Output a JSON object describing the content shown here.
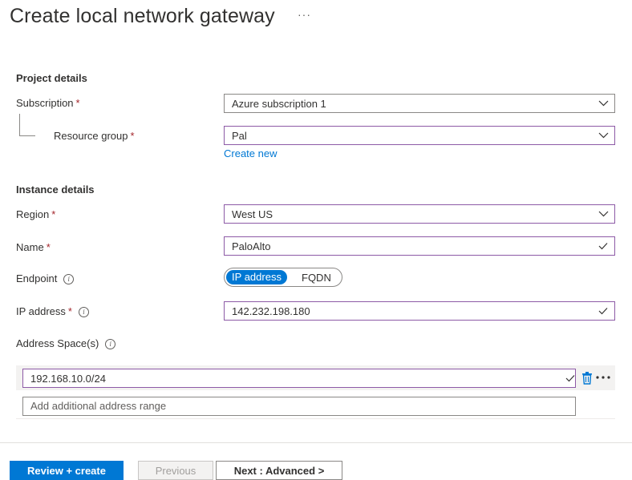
{
  "page": {
    "title": "Create local network gateway",
    "more_label": "···"
  },
  "project_details": {
    "heading": "Project details",
    "subscription": {
      "label": "Subscription",
      "required": "*",
      "value": "Azure subscription 1"
    },
    "resource_group": {
      "label": "Resource group",
      "required": "*",
      "value": "Pal",
      "create_new": "Create new"
    }
  },
  "instance_details": {
    "heading": "Instance details",
    "region": {
      "label": "Region",
      "required": "*",
      "value": "West US"
    },
    "name": {
      "label": "Name",
      "required": "*",
      "value": "PaloAlto"
    },
    "endpoint": {
      "label": "Endpoint",
      "options": [
        "IP address",
        "FQDN"
      ],
      "selected": "IP address"
    },
    "ip_address": {
      "label": "IP address",
      "required": "*",
      "value": "142.232.198.180"
    },
    "address_spaces": {
      "label": "Address Space(s)",
      "entries": [
        "192.168.10.0/24"
      ],
      "add_placeholder": "Add additional address range"
    }
  },
  "footer": {
    "review_create": "Review + create",
    "previous": "Previous",
    "next": "Next : Advanced >"
  },
  "colors": {
    "accent": "#0078d4",
    "required": "#a4262c",
    "valid_border": "#8d5aa6"
  },
  "icons": [
    "chevron-down-icon",
    "checkmark-icon",
    "info-icon",
    "delete-icon",
    "more-icon"
  ]
}
